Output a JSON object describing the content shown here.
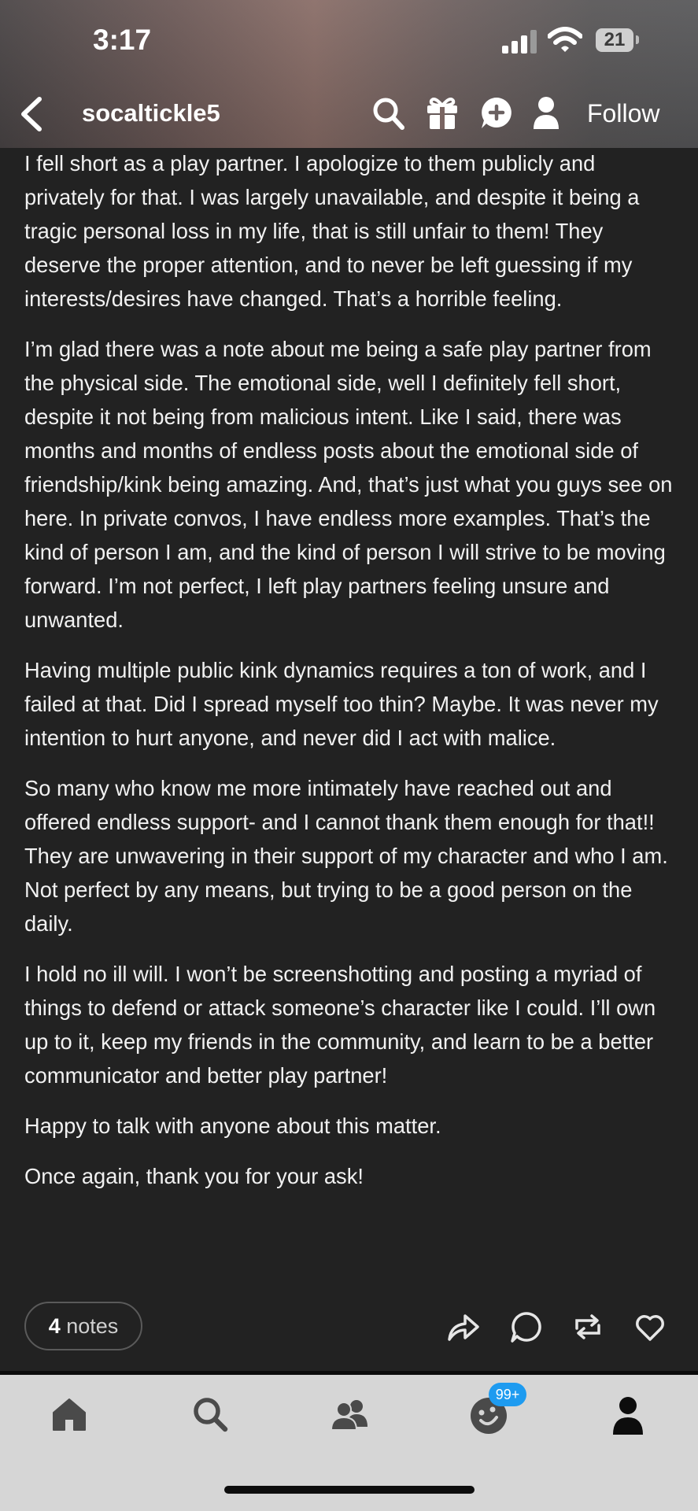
{
  "status_bar": {
    "time": "3:17",
    "battery": "21"
  },
  "header": {
    "username": "socaltickle5",
    "follow_label": "Follow"
  },
  "post": {
    "paragraphs": [
      "I fell short as a play partner. I apologize to them publicly and privately for that. I was largely unavailable, and despite it being a tragic personal loss in my life, that is still unfair to them! They deserve the proper attention, and to never be left guessing if my interests/desires have changed. That’s a horrible feeling.",
      "I’m glad there was a note about me being a safe play partner from the physical side. The emotional side, well I definitely fell short, despite it not being from malicious intent. Like I said, there was months and months of endless posts about the emotional side of friendship/kink being amazing. And, that’s just what you guys see on here. In private convos, I have endless more examples.  That’s the kind of person I am, and the kind of person I will strive to be moving forward. I’m not perfect, I left play partners feeling unsure and unwanted.",
      "Having multiple public kink dynamics requires a ton of work, and I failed at that. Did I spread myself too thin? Maybe. It was never my intention to hurt anyone, and never did I act with malice.",
      "So many who know me more intimately have reached out and offered endless support- and I cannot thank them enough for that!! They are unwavering in their support of my character and who I am. Not perfect by any means, but trying to be a good person on the daily.",
      "I hold no ill will. I won’t be screenshotting and posting a myriad of things to defend or attack someone’s character like I could. I’ll own up to it, keep my friends in the community, and learn to be a better communicator and better play partner!",
      "Happy to talk with anyone about this matter.",
      "Once again, thank you for your ask!"
    ]
  },
  "footer": {
    "notes_count": "4",
    "notes_label": "notes"
  },
  "tab_bar": {
    "badge": "99+"
  },
  "colors": {
    "background": "#222222",
    "tab_bar": "#d6d6d6",
    "badge": "#1e9bf0"
  }
}
